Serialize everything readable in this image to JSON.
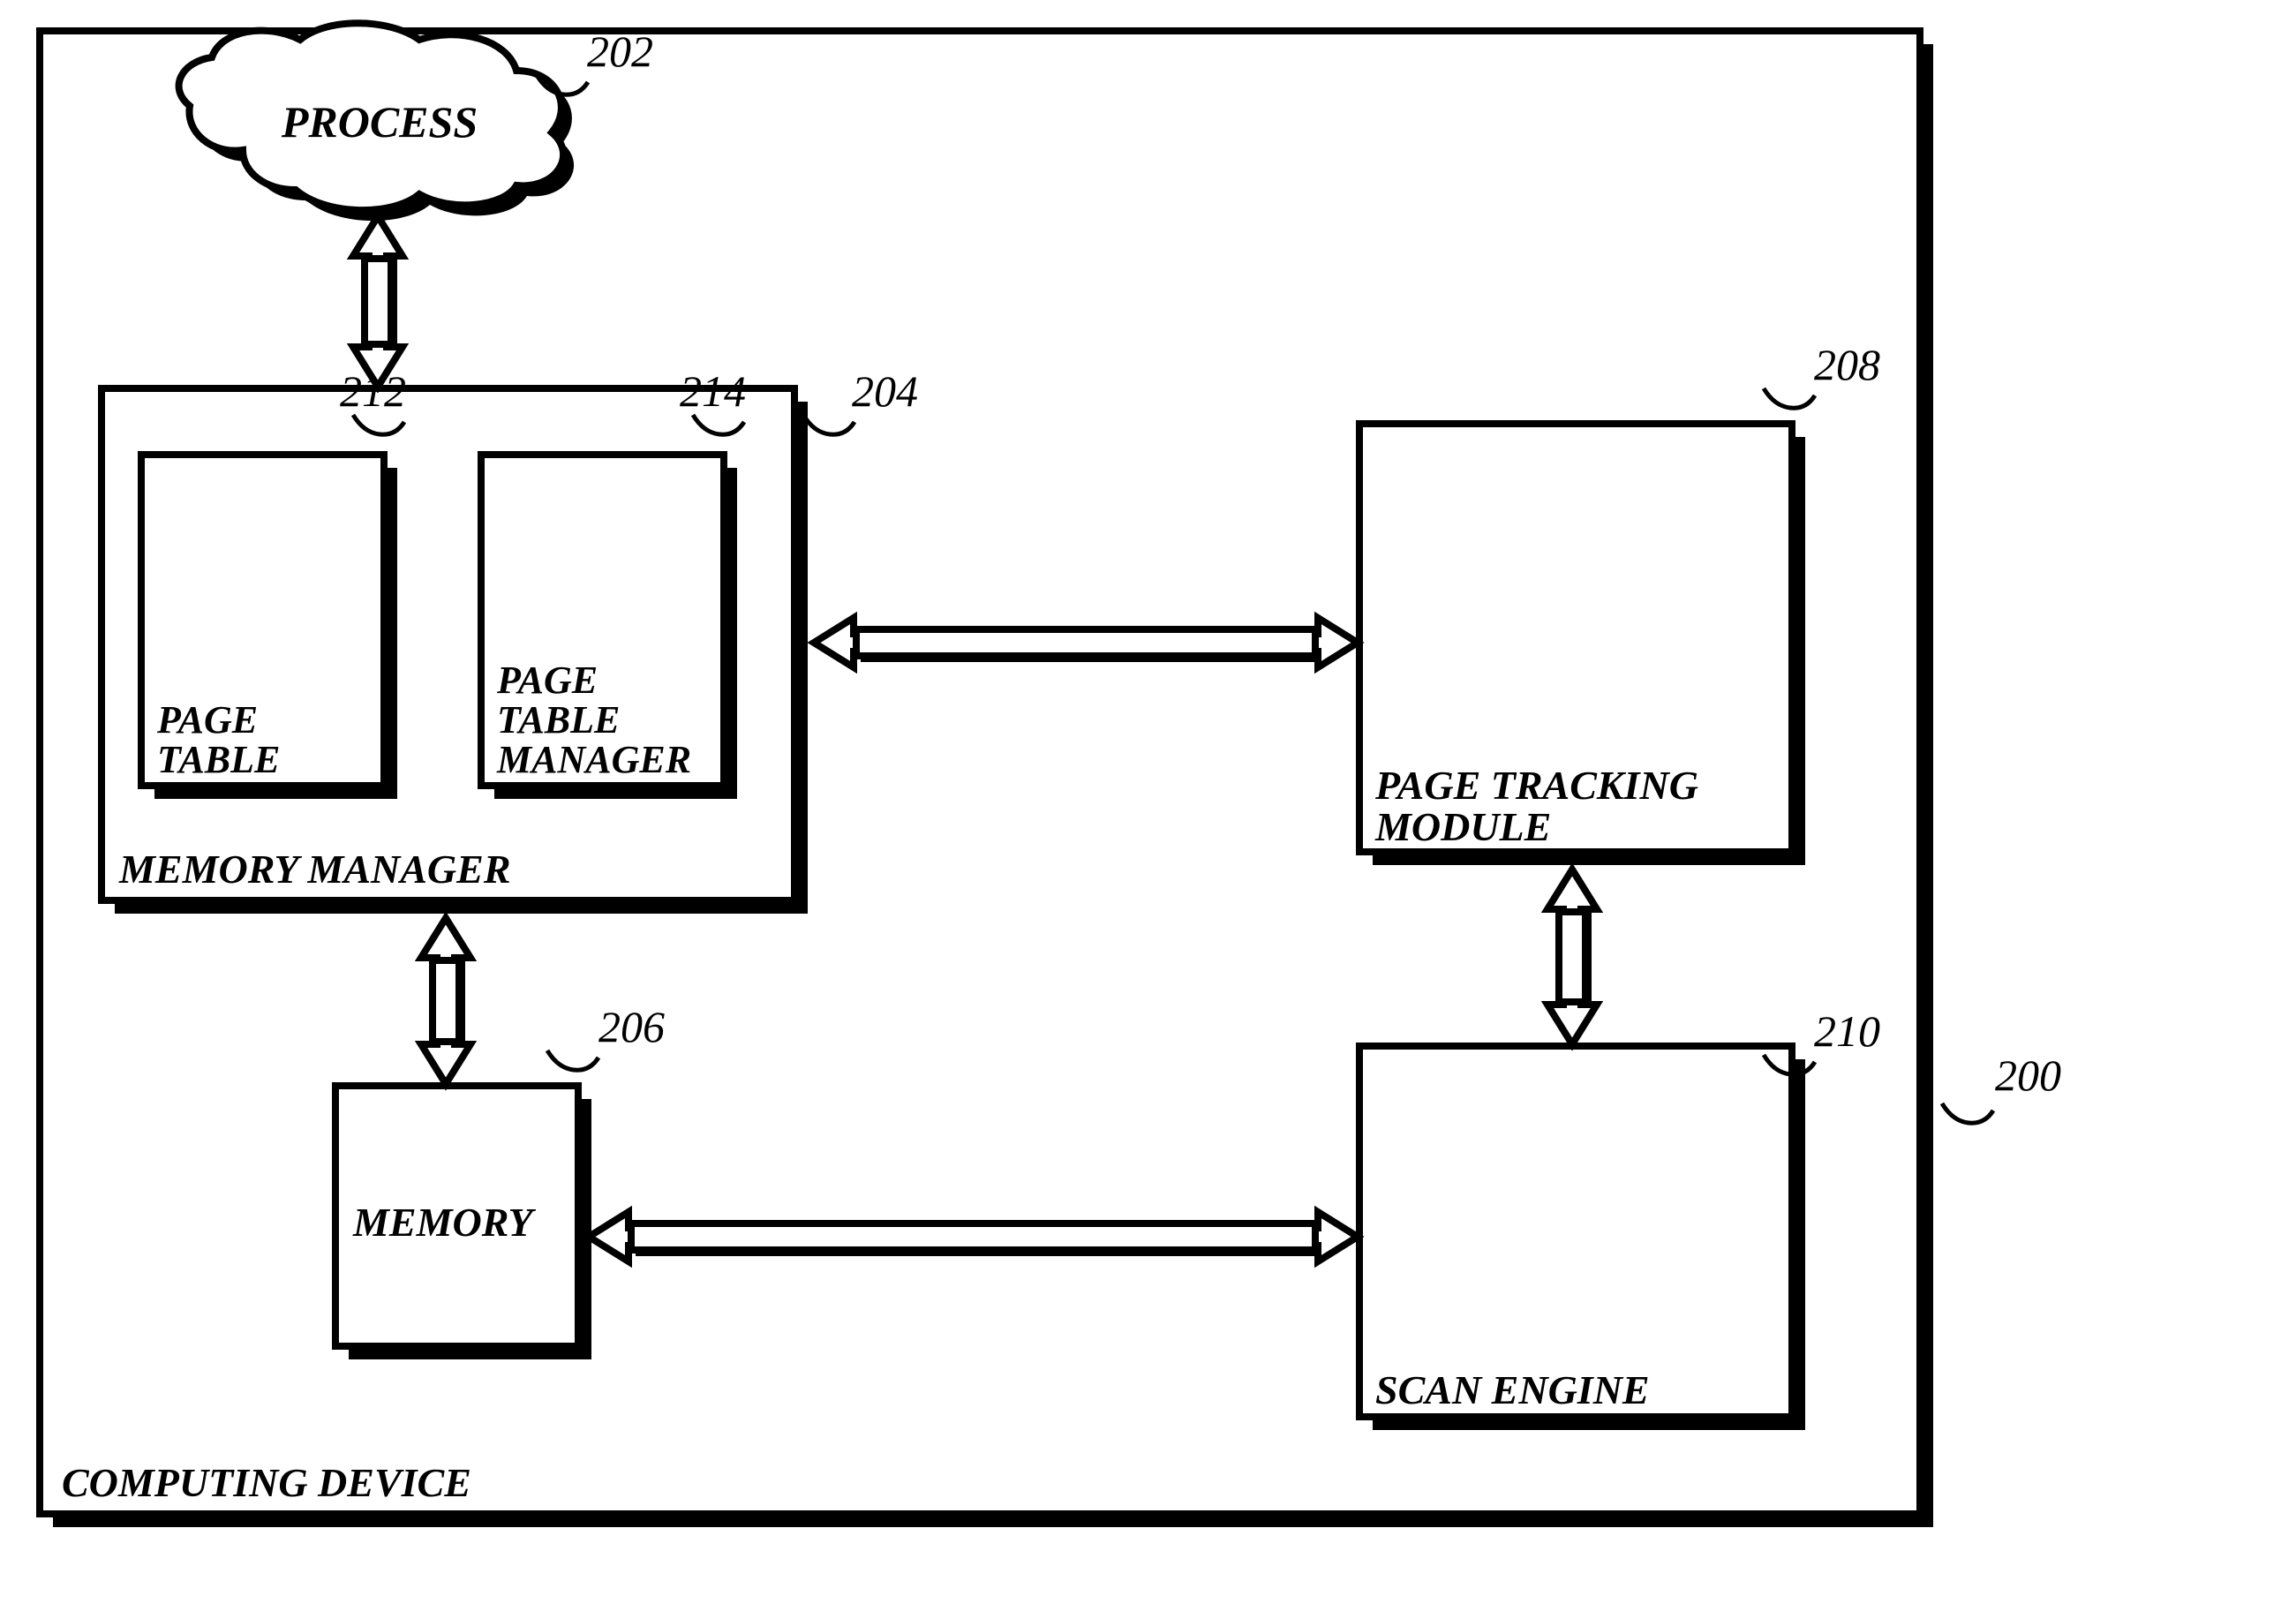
{
  "outer": {
    "label": "COMPUTING DEVICE",
    "ref": "200"
  },
  "process": {
    "label": "PROCESS",
    "ref": "202"
  },
  "memoryManager": {
    "label": "MEMORY MANAGER",
    "ref": "204",
    "pageTable": {
      "label_l1": "PAGE",
      "label_l2": "TABLE",
      "ref": "212"
    },
    "pageTableManager": {
      "label_l1": "PAGE",
      "label_l2": "TABLE",
      "label_l3": "MANAGER",
      "ref": "214"
    }
  },
  "memory": {
    "label": "MEMORY",
    "ref": "206"
  },
  "pageTracking": {
    "label_l1": "PAGE TRACKING",
    "label_l2": "MODULE",
    "ref": "208"
  },
  "scanEngine": {
    "label": "SCAN ENGINE",
    "ref": "210"
  }
}
